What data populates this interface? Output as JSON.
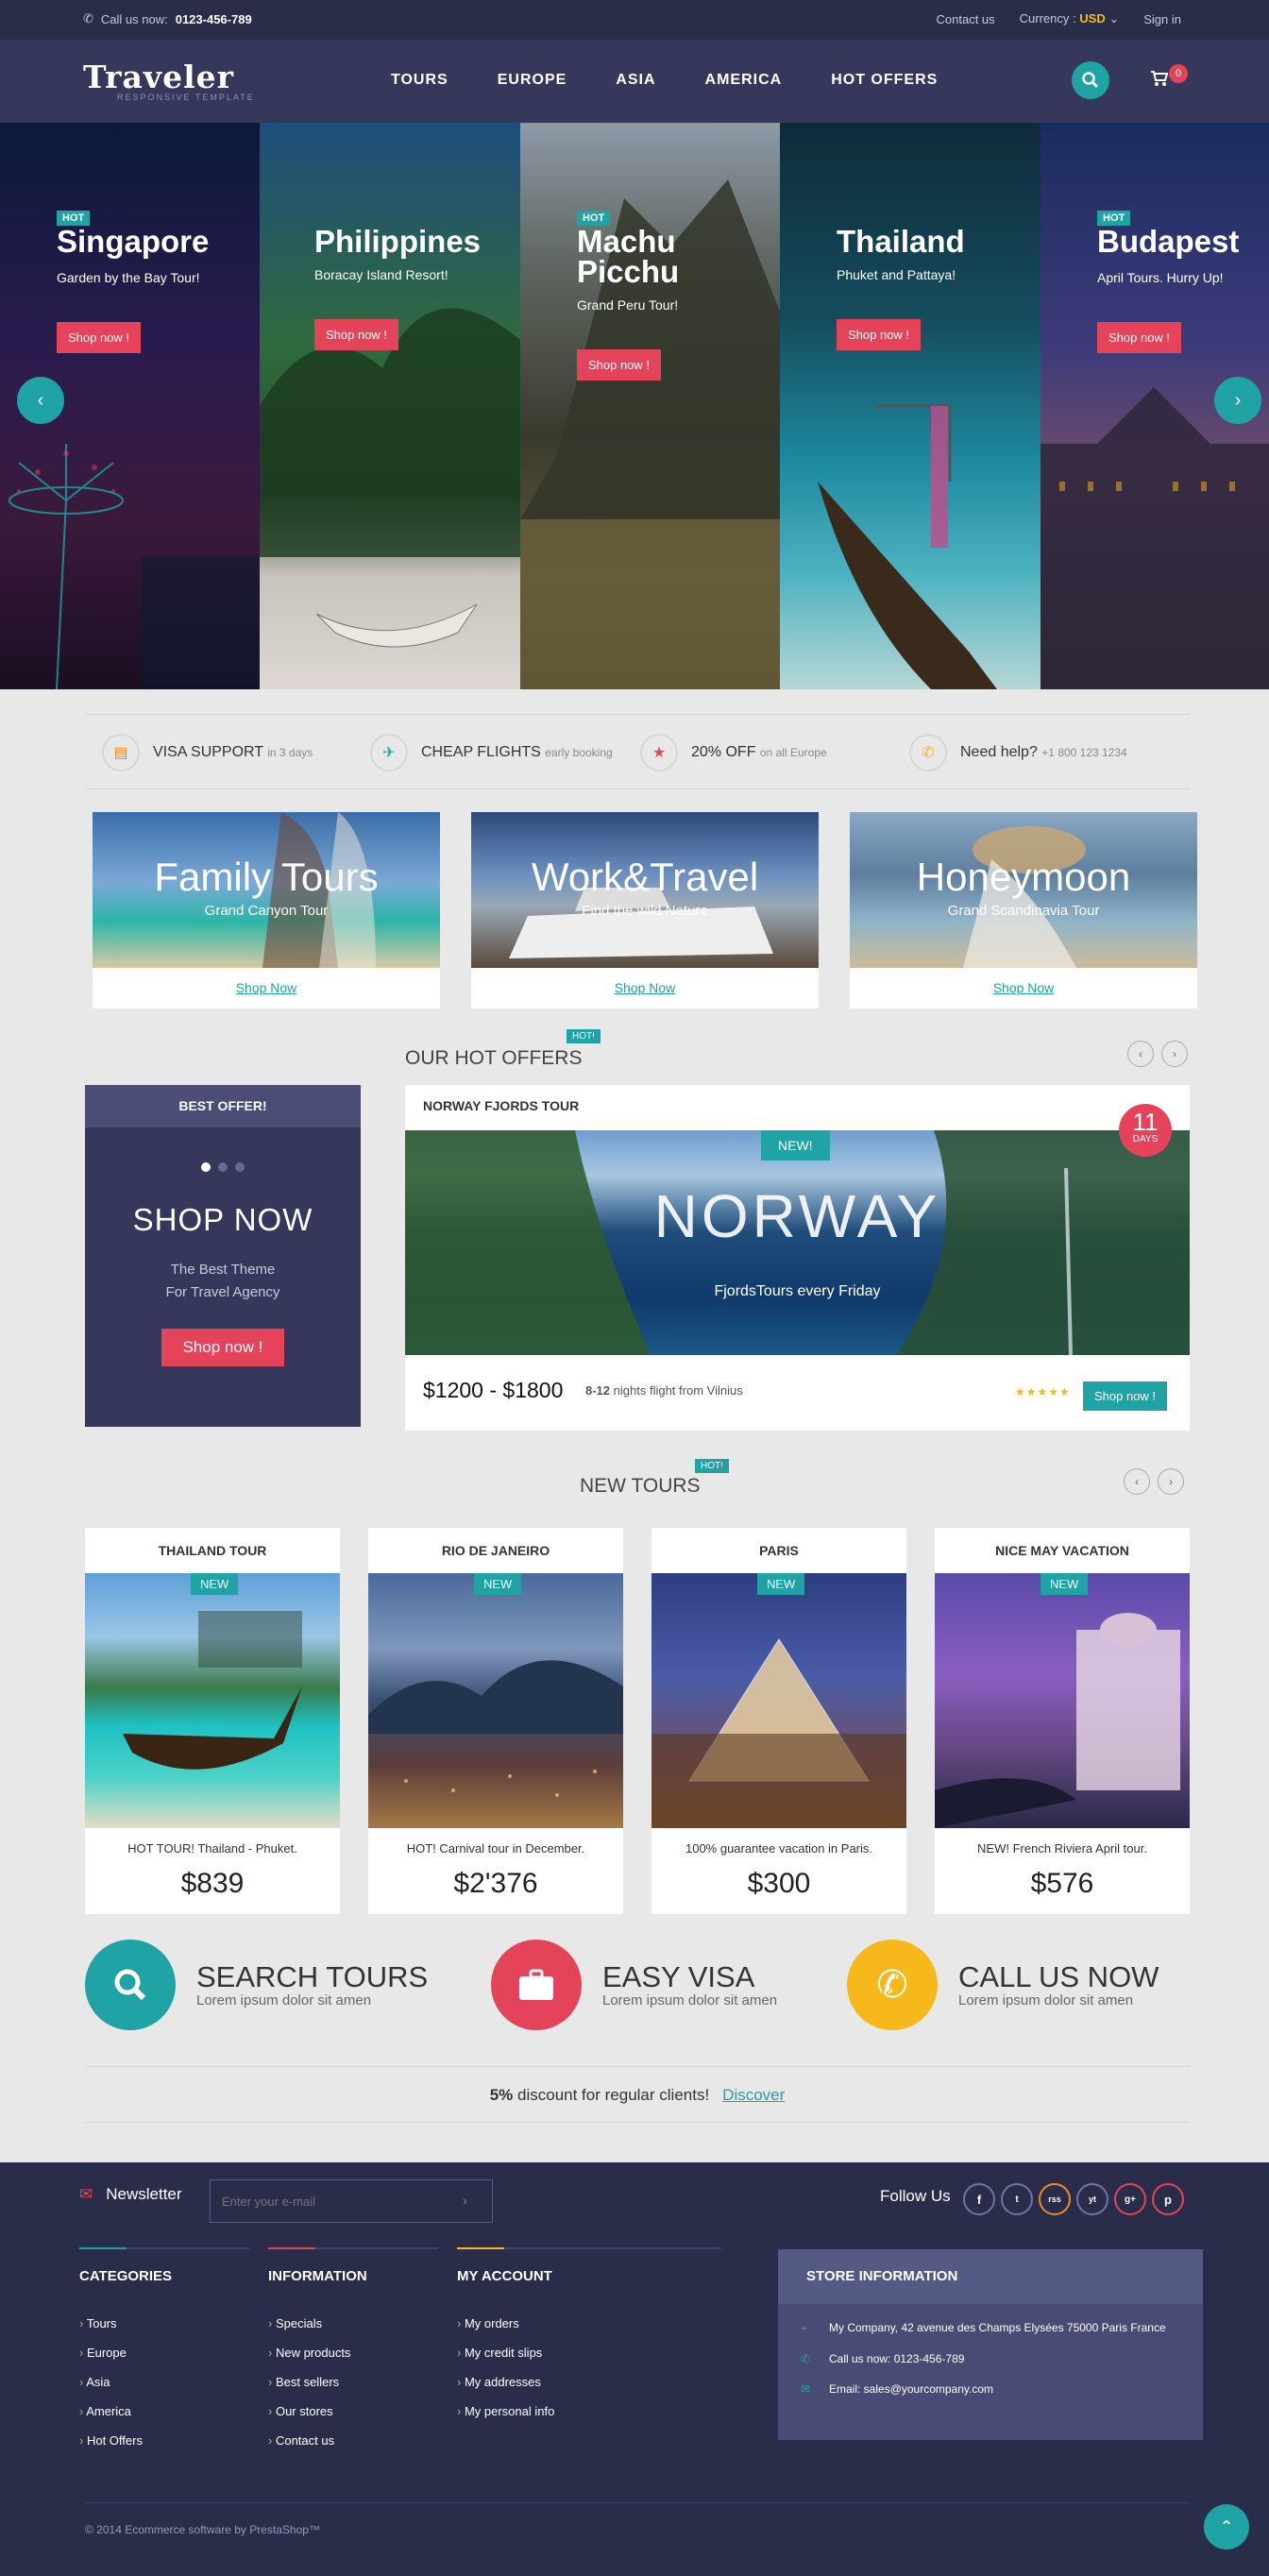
{
  "topbar": {
    "call_label": "Call us now:",
    "phone": "0123-456-789",
    "contact": "Contact us",
    "currency_label": "Currency :",
    "currency_value": "USD",
    "signin": "Sign in"
  },
  "header": {
    "logo": "Traveler",
    "logo_sub": "RESPONSIVE TEMPLATE",
    "nav": [
      "TOURS",
      "EUROPE",
      "ASIA",
      "AMERICA",
      "HOT OFFERS"
    ],
    "cart_count": "0"
  },
  "slides": [
    {
      "badge": "HOT",
      "title": "Singapore",
      "sub": "Garden by the Bay Tour!",
      "button": "Shop now !"
    },
    {
      "badge": "",
      "title": "Philippines",
      "sub": "Boracay Island Resort!",
      "button": "Shop now !"
    },
    {
      "badge": "HOT",
      "title": "Machu Picchu",
      "sub": "Grand Peru Tour!",
      "button": "Shop now !"
    },
    {
      "badge": "",
      "title": "Thailand",
      "sub": "Phuket and Pattaya!",
      "button": "Shop now !"
    },
    {
      "badge": "HOT",
      "title": "Budapest",
      "sub": "April Tours. Hurry Up!",
      "button": "Shop now !"
    }
  ],
  "features": [
    {
      "title": "VISA SUPPORT",
      "sub": "in 3 days"
    },
    {
      "title": "CHEAP FLIGHTS",
      "sub": "early booking"
    },
    {
      "title": "20% OFF",
      "sub": "on all Europe"
    },
    {
      "title": "Need help?",
      "sub": "+1 800 123 1234"
    }
  ],
  "banners": [
    {
      "title": "Family Tours",
      "sub": "Grand Canyon Tour",
      "link": "Shop Now"
    },
    {
      "title": "Work&Travel",
      "sub": "Find the wild Nature",
      "link": "Shop Now"
    },
    {
      "title": "Honeymoon",
      "sub": "Grand Scandinavia Tour",
      "link": "Shop Now"
    }
  ],
  "hot_offers": {
    "title": "OUR HOT OFFERS",
    "tag": "HOT!",
    "best": {
      "header": "BEST OFFER!",
      "big": "SHOP NOW",
      "line1": "The Best Theme",
      "line2": "For Travel Agency",
      "button": "Shop now !"
    },
    "offer": {
      "title": "NORWAY FJORDS TOUR",
      "new": "NEW!",
      "big": "NORWAY",
      "sub": "FjordsTours every Friday",
      "days_num": "11",
      "days_label": "DAYS",
      "price": "$1200 - $1800",
      "nights": "8-12",
      "note": "nights flight from Vilnius",
      "stars": "★★★★★",
      "button": "Shop now !"
    }
  },
  "new_tours": {
    "title": "NEW TOURS",
    "tag": "HOT!",
    "items": [
      {
        "title": "THAILAND TOUR",
        "badge": "NEW",
        "desc": "HOT TOUR! Thailand - Phuket.",
        "price": "$839"
      },
      {
        "title": "RIO DE JANEIRO",
        "badge": "NEW",
        "desc": "HOT! Carnival tour in December.",
        "price": "$2'376"
      },
      {
        "title": "PARIS",
        "badge": "NEW",
        "desc": "100% guarantee vacation in Paris.",
        "price": "$300"
      },
      {
        "title": "NICE MAY VACATION",
        "badge": "NEW",
        "desc": "NEW! French Riviera April tour.",
        "price": "$576"
      }
    ]
  },
  "services": [
    {
      "title": "SEARCH TOURS",
      "sub": "Lorem ipsum dolor sit amen"
    },
    {
      "title": "EASY VISA",
      "sub": "Lorem ipsum dolor sit amen"
    },
    {
      "title": "CALL US NOW",
      "sub": "Lorem ipsum dolor sit amen"
    }
  ],
  "promo": {
    "percent": "5%",
    "text": "discount for regular clients!",
    "link": "Discover"
  },
  "footer": {
    "newsletter": "Newsletter",
    "newsletter_placeholder": "Enter your e-mail",
    "follow": "Follow Us",
    "social": [
      "f",
      "t",
      "rss",
      "yt",
      "g+",
      "p"
    ],
    "categories": {
      "title": "CATEGORIES",
      "items": [
        "Tours",
        "Europe",
        "Asia",
        "America",
        "Hot Offers"
      ]
    },
    "information": {
      "title": "INFORMATION",
      "items": [
        "Specials",
        "New products",
        "Best sellers",
        "Our stores",
        "Contact us"
      ]
    },
    "account": {
      "title": "MY ACCOUNT",
      "items": [
        "My orders",
        "My credit slips",
        "My addresses",
        "My personal info"
      ]
    },
    "store": {
      "title": "STORE INFORMATION",
      "address": "My Company, 42 avenue des Champs Elysées 75000 Paris France",
      "phone": "Call us now: 0123-456-789",
      "email": "Email: sales@yourcompany.com"
    },
    "copyright": "© 2014 Ecommerce software by PrestaShop™"
  },
  "colors": {
    "accent": "#1fa3a5",
    "brand_dark": "#35385b",
    "hot": "#e5435a",
    "gold": "#f6b81a"
  }
}
